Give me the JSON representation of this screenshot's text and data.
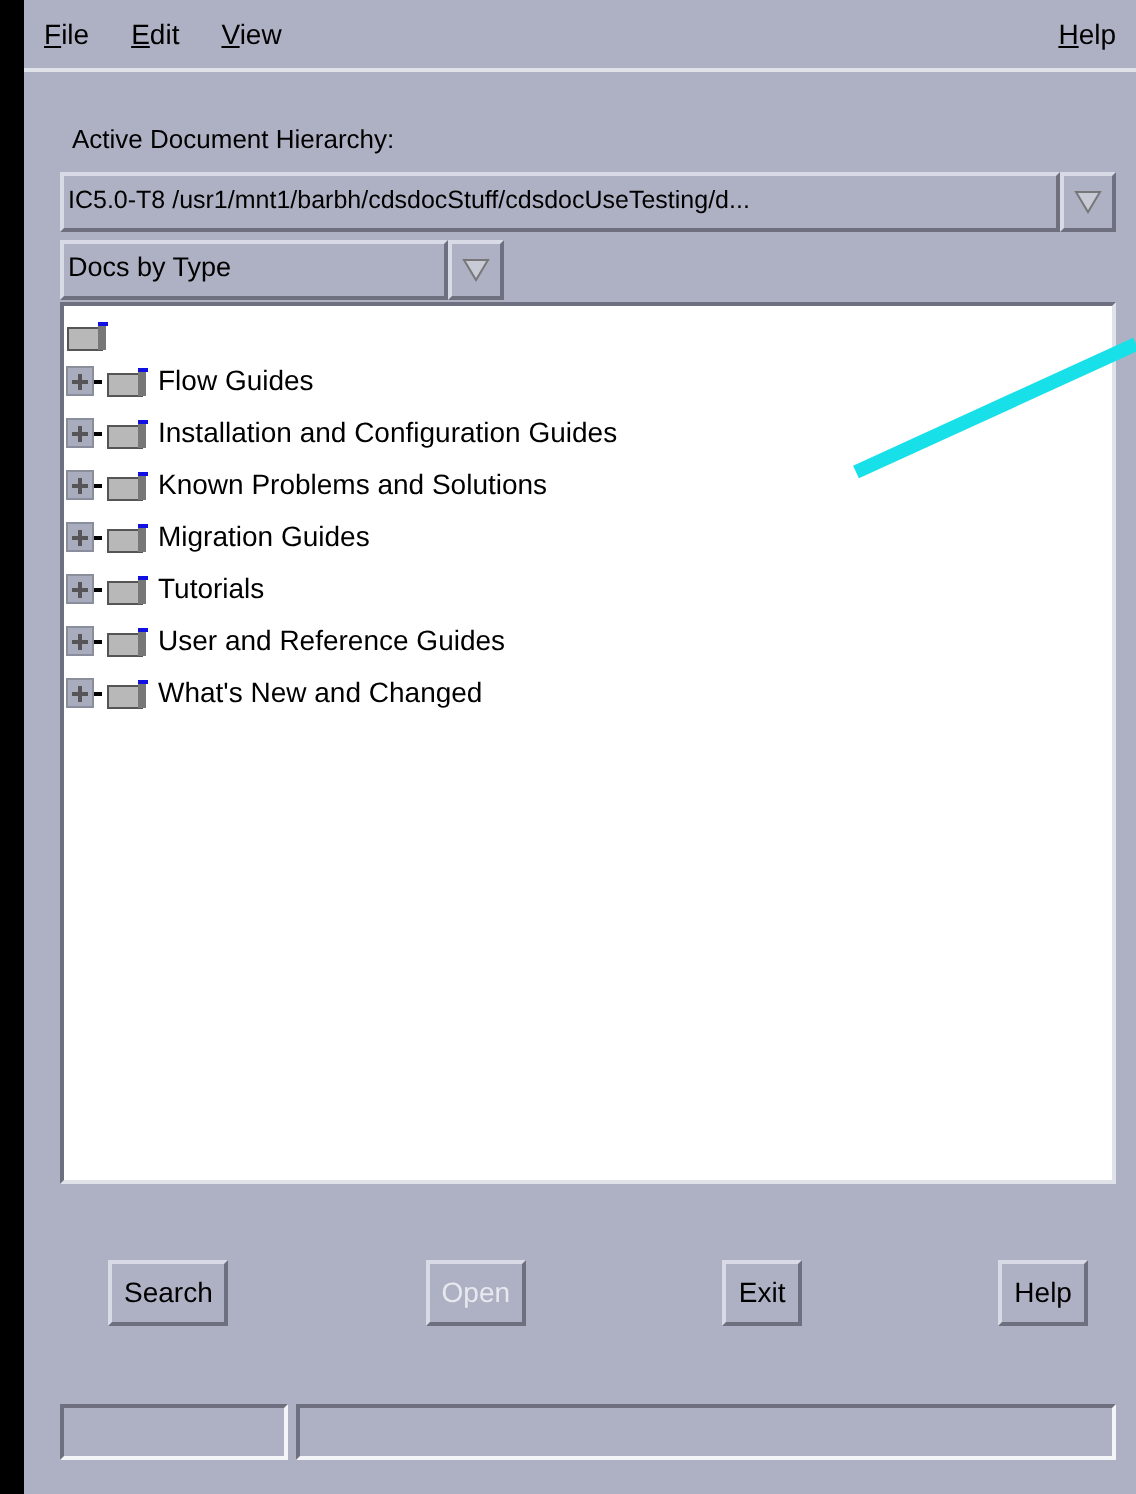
{
  "menu_bar": [
    {
      "mnemonic": "F",
      "rest": "ile"
    },
    {
      "mnemonic": "E",
      "rest": "dit"
    },
    {
      "mnemonic": "V",
      "rest": "iew"
    },
    {
      "mnemonic": "H",
      "rest": "elp"
    }
  ],
  "hierarchy": {
    "label": "Active Document Hierarchy:",
    "value": "IC5.0-T8   /usr1/mnt1/barbh/cdsdocStuff/cdsdocUseTesting/d..."
  },
  "view_select": {
    "value": "Docs by Type"
  },
  "tree": {
    "children": [
      {
        "label": "Flow Guides",
        "expanded": false
      },
      {
        "label": "Installation and Configuration Guides",
        "expanded": false
      },
      {
        "label": "Known Problems and Solutions",
        "expanded": false
      },
      {
        "label": "Migration Guides",
        "expanded": false
      },
      {
        "label": "Tutorials",
        "expanded": false
      },
      {
        "label": "User and Reference Guides",
        "expanded": false
      },
      {
        "label": "What's New and Changed",
        "expanded": false
      }
    ]
  },
  "buttons": [
    {
      "label": "Search",
      "disabled": false
    },
    {
      "label": "Open",
      "disabled": true
    },
    {
      "label": "Exit",
      "disabled": false
    },
    {
      "label": "Help",
      "disabled": false
    }
  ]
}
